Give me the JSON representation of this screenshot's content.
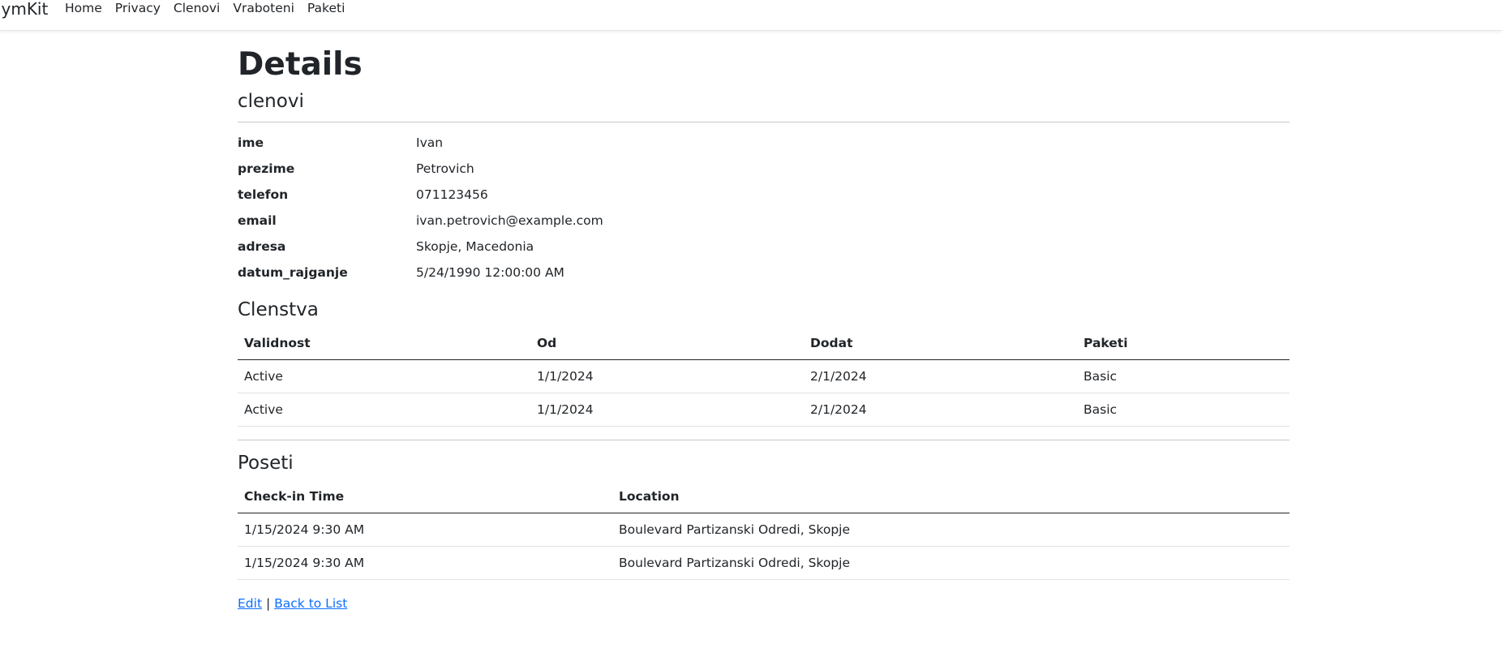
{
  "nav": {
    "brand": "GymKit",
    "items": [
      "Home",
      "Privacy",
      "Clenovi",
      "Vraboteni",
      "Paketi"
    ]
  },
  "page": {
    "title": "Details",
    "subtitle": "clenovi"
  },
  "details": [
    {
      "label": "ime",
      "value": "Ivan"
    },
    {
      "label": "prezime",
      "value": "Petrovich"
    },
    {
      "label": "telefon",
      "value": "071123456"
    },
    {
      "label": "email",
      "value": "ivan.petrovich@example.com"
    },
    {
      "label": "adresa",
      "value": "Skopje, Macedonia"
    },
    {
      "label": "datum_rajganje",
      "value": "5/24/1990 12:00:00 AM"
    }
  ],
  "clenstva": {
    "heading": "Clenstva",
    "columns": [
      "Validnost",
      "Od",
      "Dodat",
      "Paketi"
    ],
    "rows": [
      [
        "Active",
        "1/1/2024",
        "2/1/2024",
        "Basic"
      ],
      [
        "Active",
        "1/1/2024",
        "2/1/2024",
        "Basic"
      ]
    ]
  },
  "poseti": {
    "heading": "Poseti",
    "columns": [
      "Check-in Time",
      "Location"
    ],
    "rows": [
      [
        "1/15/2024 9:30 AM",
        "Boulevard Partizanski Odredi, Skopje"
      ],
      [
        "1/15/2024 9:30 AM",
        "Boulevard Partizanski Odredi, Skopje"
      ]
    ]
  },
  "links": {
    "edit": "Edit",
    "separator": "|",
    "back": "Back to List"
  },
  "colors": {
    "link": "#0d6efd",
    "text": "#212529"
  }
}
